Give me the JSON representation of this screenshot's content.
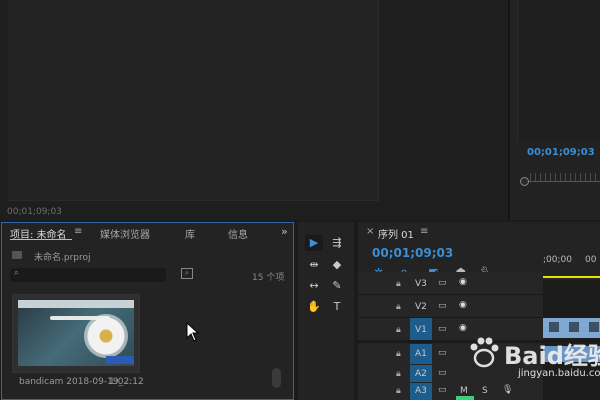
{
  "source_monitor": {
    "timecode": "00;01;09;03"
  },
  "program_monitor": {
    "timecode": "00;01;09;03"
  },
  "project_panel": {
    "tabs": [
      {
        "label": "项目: 未命名",
        "active": true
      },
      {
        "label": "媒体浏览器",
        "active": false
      },
      {
        "label": "库",
        "active": false
      },
      {
        "label": "信息",
        "active": false
      }
    ],
    "menu_glyph": "≡",
    "expand_glyph": "»",
    "project_file": "未命名.prproj",
    "search_placeholder": "",
    "item_count": "15 个项",
    "clip": {
      "name": "bandicam 2018-09-19_...",
      "duration": "1:02:12"
    }
  },
  "timeline": {
    "close_glyph": "×",
    "title": "序列 01",
    "menu_glyph": "≡",
    "timecode": "00;01;09;03",
    "ruler_label": ";00;00",
    "ruler_label_2": "00",
    "tracks": [
      {
        "name": "V3",
        "type": "video"
      },
      {
        "name": "V2",
        "type": "video"
      },
      {
        "name": "V1",
        "type": "video"
      },
      {
        "name": "A1",
        "type": "audio"
      },
      {
        "name": "A2",
        "type": "audio"
      },
      {
        "name": "A3",
        "type": "audio"
      }
    ],
    "a3_controls": {
      "m": "M",
      "s": "S"
    }
  },
  "watermark": {
    "brand": "Baid经验",
    "url": "jingyan.baidu.com"
  },
  "colors": {
    "accent": "#3a8fd6",
    "playhead": "#e5e300",
    "track_target": "#1d5d8e"
  }
}
